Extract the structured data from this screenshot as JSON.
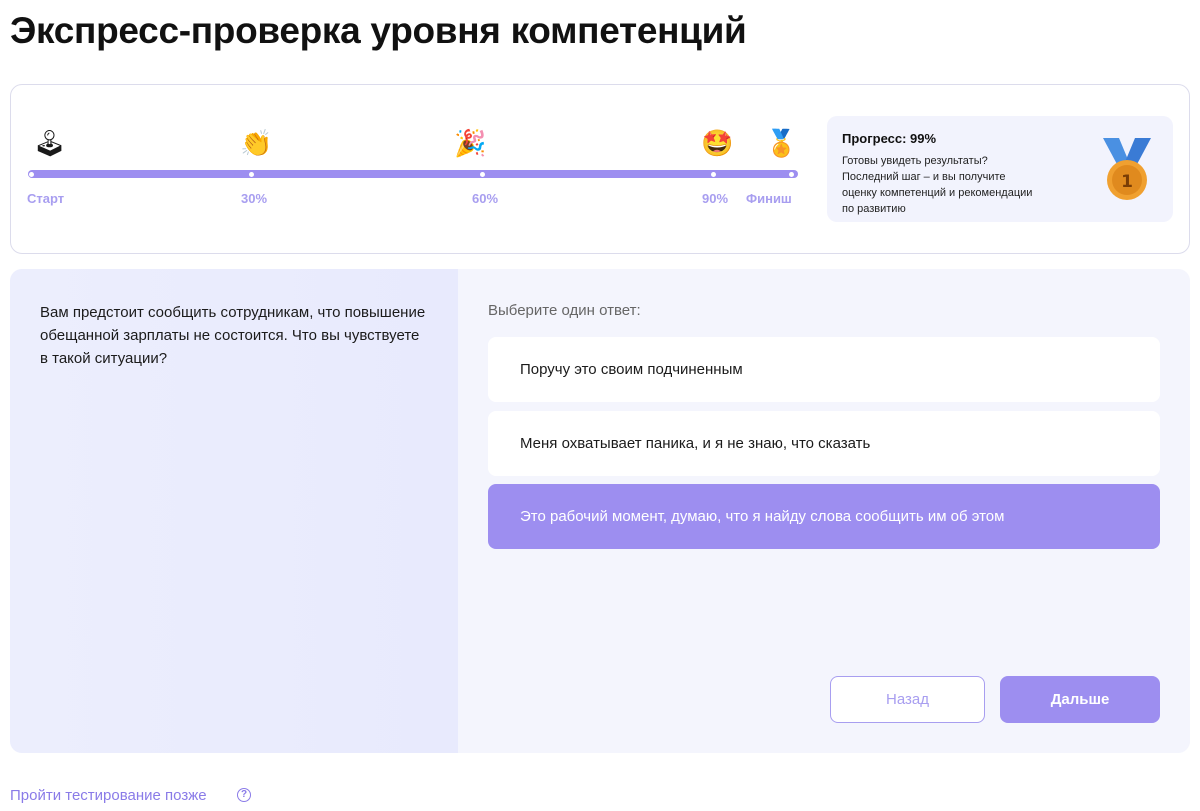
{
  "page": {
    "title": "Экспресс-проверка уровня компетенций"
  },
  "progress": {
    "milestones": [
      {
        "label": "Старт",
        "icon": "joystick-icon",
        "glyph": "🕹"
      },
      {
        "label": "30%",
        "icon": "clapping-hands-icon",
        "glyph": "👏"
      },
      {
        "label": "60%",
        "icon": "party-horn-icon",
        "glyph": "🎉"
      },
      {
        "label": "90%",
        "icon": "star-struck-icon",
        "glyph": "🤩"
      },
      {
        "label": "Финиш",
        "icon": "medal-icon",
        "glyph": "🏅"
      }
    ],
    "info": {
      "title": "Прогресс: 99%",
      "text": "Готовы увидеть результаты? Последний шаг – и вы получите оценку компетенций и рекомендации по развитию",
      "percent": 99
    }
  },
  "question": {
    "text": "Вам предстоит сообщить сотрудникам, что повышение обещанной зарплаты не состоится. Что вы чувствуете в такой ситуации?",
    "prompt": "Выберите один ответ:",
    "answers": [
      {
        "label": "Поручу это своим подчиненным",
        "selected": false
      },
      {
        "label": "Меня охватывает паника, и я не знаю, что сказать",
        "selected": false
      },
      {
        "label": "Это рабочий момент, думаю, что я найду слова сообщить им об этом",
        "selected": true
      }
    ]
  },
  "buttons": {
    "back": "Назад",
    "next": "Дальше"
  },
  "footer": {
    "later_link": "Пройти тестирование позже",
    "help": "?"
  },
  "colors": {
    "accent": "#9d8ef0",
    "accent_text": "#a89ef0",
    "panel_bg": "#f4f5fd"
  }
}
